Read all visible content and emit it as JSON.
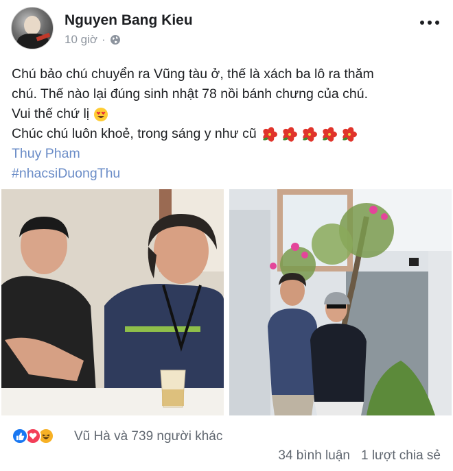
{
  "header": {
    "author_name": "Nguyen Bang Kieu",
    "time": "10 giờ",
    "separator": "·",
    "privacy_icon": "globe-icon",
    "more_icon": "more-options-icon"
  },
  "post": {
    "lines": [
      "Chú bảo chú chuyển ra Vũng tàu ở, thế là xách ba lô ra thăm",
      "chú. Thế nào lại đúng sinh nhật 78 nồi bánh chưng của chú.",
      "Vui thế chứ lị",
      "Chúc chú luôn khoẻ, trong sáng y như cũ"
    ],
    "emoji_after_line3": "heart-eyes-emoji",
    "hibiscus_count": 5,
    "tagged_person": "Thuy Pham",
    "hashtag": "#nhacsiDuongThu"
  },
  "photos": {
    "left": "two-men-seated-photo",
    "right": "two-men-garden-photo"
  },
  "footer": {
    "reaction_icons": [
      "like-icon",
      "love-icon",
      "haha-icon"
    ],
    "reaction_summary": "Vũ Hà và 739 người khác",
    "comments": "34 bình luận",
    "shares": "1 lượt chia sẻ"
  },
  "colors": {
    "text": "#1c1e21",
    "meta": "#8d949e",
    "link": "#6a8cc7",
    "like": "#1877f2",
    "love": "#f33e58",
    "haha": "#f7b125"
  }
}
